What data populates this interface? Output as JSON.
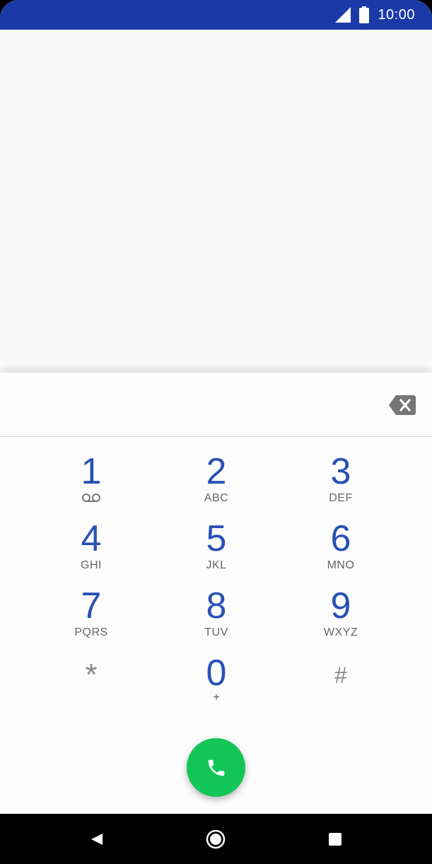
{
  "status_bar": {
    "time": "10:00",
    "icons": [
      "signal-icon",
      "battery-icon"
    ],
    "background": "#1b3aa8"
  },
  "dialer": {
    "digits_value": "",
    "keys": [
      {
        "digit": "1",
        "letters": ""
      },
      {
        "digit": "2",
        "letters": "ABC"
      },
      {
        "digit": "3",
        "letters": "DEF"
      },
      {
        "digit": "4",
        "letters": "GHI"
      },
      {
        "digit": "5",
        "letters": "JKL"
      },
      {
        "digit": "6",
        "letters": "MNO"
      },
      {
        "digit": "7",
        "letters": "PQRS"
      },
      {
        "digit": "8",
        "letters": "TUV"
      },
      {
        "digit": "9",
        "letters": "WXYZ"
      },
      {
        "digit": "*",
        "letters": ""
      },
      {
        "digit": "0",
        "letters": "+"
      },
      {
        "digit": "#",
        "letters": ""
      }
    ],
    "digit_color": "#2851b5",
    "call_button_color": "#12c557"
  },
  "nav_bar": {
    "icons": [
      "back-icon",
      "home-icon",
      "recents-icon"
    ]
  }
}
